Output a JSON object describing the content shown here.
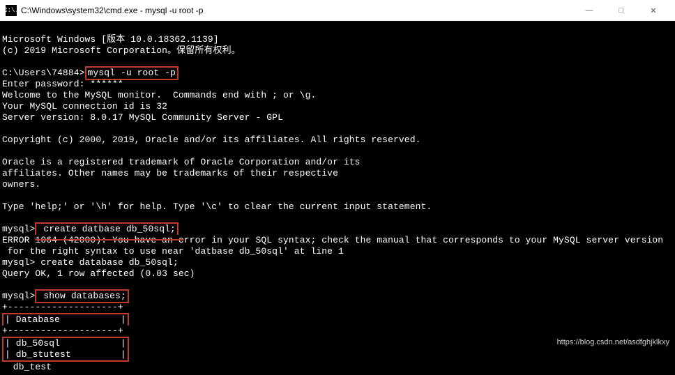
{
  "titlebar": {
    "icon_text": "C:\\.",
    "title": "C:\\Windows\\system32\\cmd.exe - mysql  -u root -p"
  },
  "window_controls": {
    "minimize": "—",
    "maximize": "□",
    "close": "✕"
  },
  "terminal": {
    "ms_windows_version": "Microsoft Windows [版本 10.0.18362.1139]",
    "ms_copyright": "(c) 2019 Microsoft Corporation。保留所有权利。",
    "prompt_path": "C:\\Users\\74884>",
    "cmd_mysql": "mysql -u root -p",
    "enter_password": "Enter password: ******",
    "welcome": "Welcome to the MySQL monitor.  Commands end with ; or \\g.",
    "connection_id": "Your MySQL connection id is 32",
    "server_version": "Server version: 8.0.17 MySQL Community Server - GPL",
    "oracle_copyright": "Copyright (c) 2000, 2019, Oracle and/or its affiliates. All rights reserved.",
    "oracle_tm1": "Oracle is a registered trademark of Oracle Corporation and/or its",
    "oracle_tm2": "affiliates. Other names may be trademarks of their respective",
    "oracle_tm3": "owners.",
    "help_line": "Type 'help;' or '\\h' for help. Type '\\c' to clear the current input statement.",
    "mysql_prompt": "mysql>",
    "cmd_create_bad": " create datbase db_50sql;",
    "error_line1a": "ERROR ",
    "error_line1b": "1064 (42000): You have an e",
    "error_line1c": "rror in your SQL syntax; check the manual that corresponds to your MySQL server version",
    "error_line2": " for the right syntax to use near 'datbase db_50sql' at line 1",
    "cmd_create_good": " create database db_50sql;",
    "query_ok": "Query OK, 1 row affected (0.03 sec)",
    "cmd_show_db": " show databases;",
    "table_sep": "+--------------------+",
    "table_header": "| Database           |",
    "table_row1": "| db_50sql           |",
    "table_row2": "| db_stutest         |",
    "table_row3_partial": "  db_test"
  },
  "watermark": "https://blog.csdn.net/asdfghjklkxy"
}
